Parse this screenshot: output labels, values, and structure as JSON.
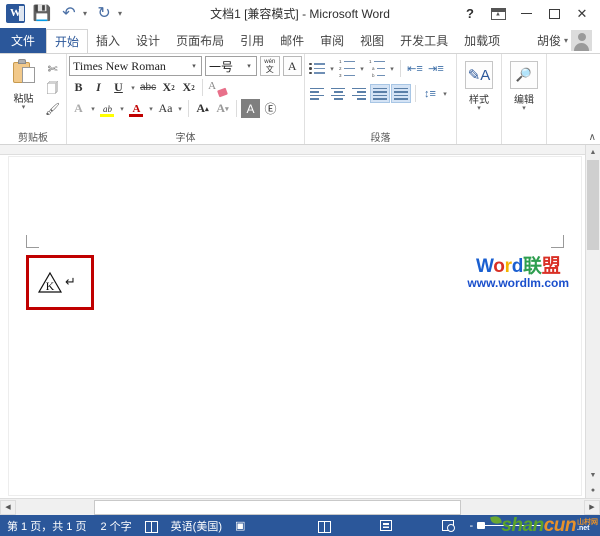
{
  "titlebar": {
    "app_icon": "word-logo",
    "quick_access": [
      {
        "name": "save",
        "glyph": "ὋE"
      },
      {
        "name": "undo",
        "glyph": "↶"
      },
      {
        "name": "redo",
        "glyph": "↻"
      },
      {
        "name": "customize-qat",
        "glyph": "▾"
      }
    ],
    "title": "文档1 [兼容模式] - Microsoft Word",
    "help_label": "?",
    "ribbon_display_label": "",
    "minimize_label": "",
    "maximize_label": "",
    "close_label": "✕"
  },
  "tabs": {
    "file": "文件",
    "items": [
      {
        "label": "开始",
        "active": true
      },
      {
        "label": "插入",
        "active": false
      },
      {
        "label": "设计",
        "active": false
      },
      {
        "label": "页面布局",
        "active": false
      },
      {
        "label": "引用",
        "active": false
      },
      {
        "label": "邮件",
        "active": false
      },
      {
        "label": "审阅",
        "active": false
      },
      {
        "label": "视图",
        "active": false
      },
      {
        "label": "开发工具",
        "active": false
      },
      {
        "label": "加载项",
        "active": false
      }
    ],
    "user_name": "胡俊"
  },
  "ribbon": {
    "clipboard": {
      "label": "剪贴板",
      "paste_label": "粘贴",
      "cut_label": "剪切",
      "copy_label": "复制",
      "format_painter_label": "格式刷"
    },
    "font": {
      "label": "字体",
      "font_name": "Times New Roman",
      "font_size": "一号",
      "phonetic_guide_label": "拼音指南",
      "enclose_char_label": "带圈字符",
      "bold_label": "B",
      "italic_label": "I",
      "underline_label": "U",
      "strikethrough_label": "abc",
      "subscript_label": "X₂",
      "superscript_label": "X²",
      "clear_format_label": "清除格式",
      "text_effects_label": "A",
      "highlight_label": "ab",
      "font_color_label": "A",
      "change_case_label": "Aa",
      "grow_font_label": "A",
      "shrink_font_label": "A",
      "char_shading_label": "A",
      "char_border_label": "Ⓔ"
    },
    "paragraph": {
      "label": "段落",
      "bullets_label": "项目符号",
      "numbering_label": "编号",
      "multilevel_label": "多级列表",
      "decrease_indent_label": "减少缩进",
      "increase_indent_label": "增加缩进",
      "align_left_label": "左对齐",
      "align_center_label": "居中",
      "align_right_label": "右对齐",
      "justify_label": "两端对齐",
      "distribute_label": "分散对齐",
      "line_spacing_label": "行距"
    },
    "styles": {
      "label": "样式"
    },
    "editing": {
      "label": "编辑"
    },
    "collapse_label": "∧"
  },
  "document": {
    "content_char": "K",
    "paragraph_mark": "↵",
    "watermark": {
      "line1_parts": [
        {
          "text": "W",
          "color": "#1a5fd0"
        },
        {
          "text": "o",
          "color": "#d93025"
        },
        {
          "text": "r",
          "color": "#f5b400"
        },
        {
          "text": "d",
          "color": "#1a5fd0"
        },
        {
          "text": "联",
          "color": "#2e9e4f"
        },
        {
          "text": "盟",
          "color": "#d93025"
        }
      ],
      "line2": "www.wordlm.com"
    }
  },
  "scrollbars": {
    "up_arrow": "▲",
    "down_arrow": "▼",
    "left_arrow": "◀",
    "right_arrow": "▶"
  },
  "statusbar": {
    "page_info": "第 1 页，共 1 页",
    "word_count": "2 个字",
    "proofing_label": "校对",
    "language": "英语(美国)",
    "macro_label": "宏",
    "view_read_label": "阅读视图",
    "view_print_label": "页面视图",
    "view_web_label": "Web版式视图",
    "zoom_out_label": "-",
    "logo": {
      "part1": "shan",
      "part1_color": "#5ba32b",
      "part2": "cun",
      "part2_color": "#e8922a",
      "suffix_top": "山村网",
      "suffix_bottom": ".net"
    }
  },
  "colors": {
    "accent": "#2b579a",
    "highlight_box": "#c00000",
    "ribbon_selected": "#d4e3f5"
  }
}
